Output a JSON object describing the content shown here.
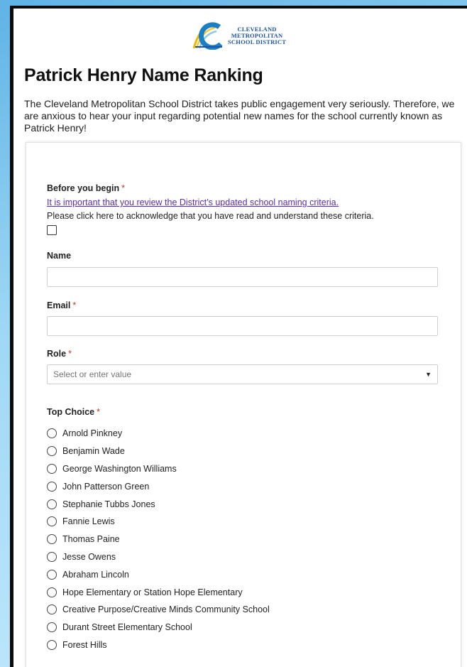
{
  "logo": {
    "lines": [
      "CLEVELAND",
      "METROPOLITAN",
      "SCHOOL DISTRICT"
    ]
  },
  "title": "Patrick Henry Name Ranking",
  "intro": "The Cleveland Metropolitan School District takes public engagement very seriously. Therefore, we are anxious to hear your input regarding potential new names for the school currently known as Patrick Henry!",
  "form": {
    "before": {
      "label": "Before you begin",
      "required_mark": "*",
      "link_text": "It is important that you review the District’s updated school naming criteria.",
      "ack_text": "Please click here to acknowledge that you have read and understand these criteria."
    },
    "name": {
      "label": "Name",
      "value": ""
    },
    "email": {
      "label": "Email",
      "required_mark": "*",
      "value": ""
    },
    "role": {
      "label": "Role",
      "required_mark": "*",
      "placeholder": "Select or enter value"
    },
    "top_choice": {
      "label": "Top Choice",
      "required_mark": "*",
      "options": [
        "Arnold Pinkney",
        "Benjamin Wade",
        "George Washington Williams",
        "John Patterson Green",
        "Stephanie Tubbs Jones",
        "Fannie Lewis",
        "Thomas Paine",
        "Jesse Owens",
        "Abraham Lincoln",
        "Hope Elementary or Station Hope Elementary",
        "Creative Purpose/Creative Minds Community School",
        "Durant Street Elementary School",
        "Forest Hills"
      ]
    }
  },
  "icons": {
    "logo": "district-logo-icon",
    "caret": "caret-down-icon",
    "radio": "radio-icon"
  },
  "colors": {
    "required": "#c0392b",
    "link": "#5b2ea6",
    "logo_blue": "#1c55a5",
    "logo_yellow": "#f2b705"
  }
}
